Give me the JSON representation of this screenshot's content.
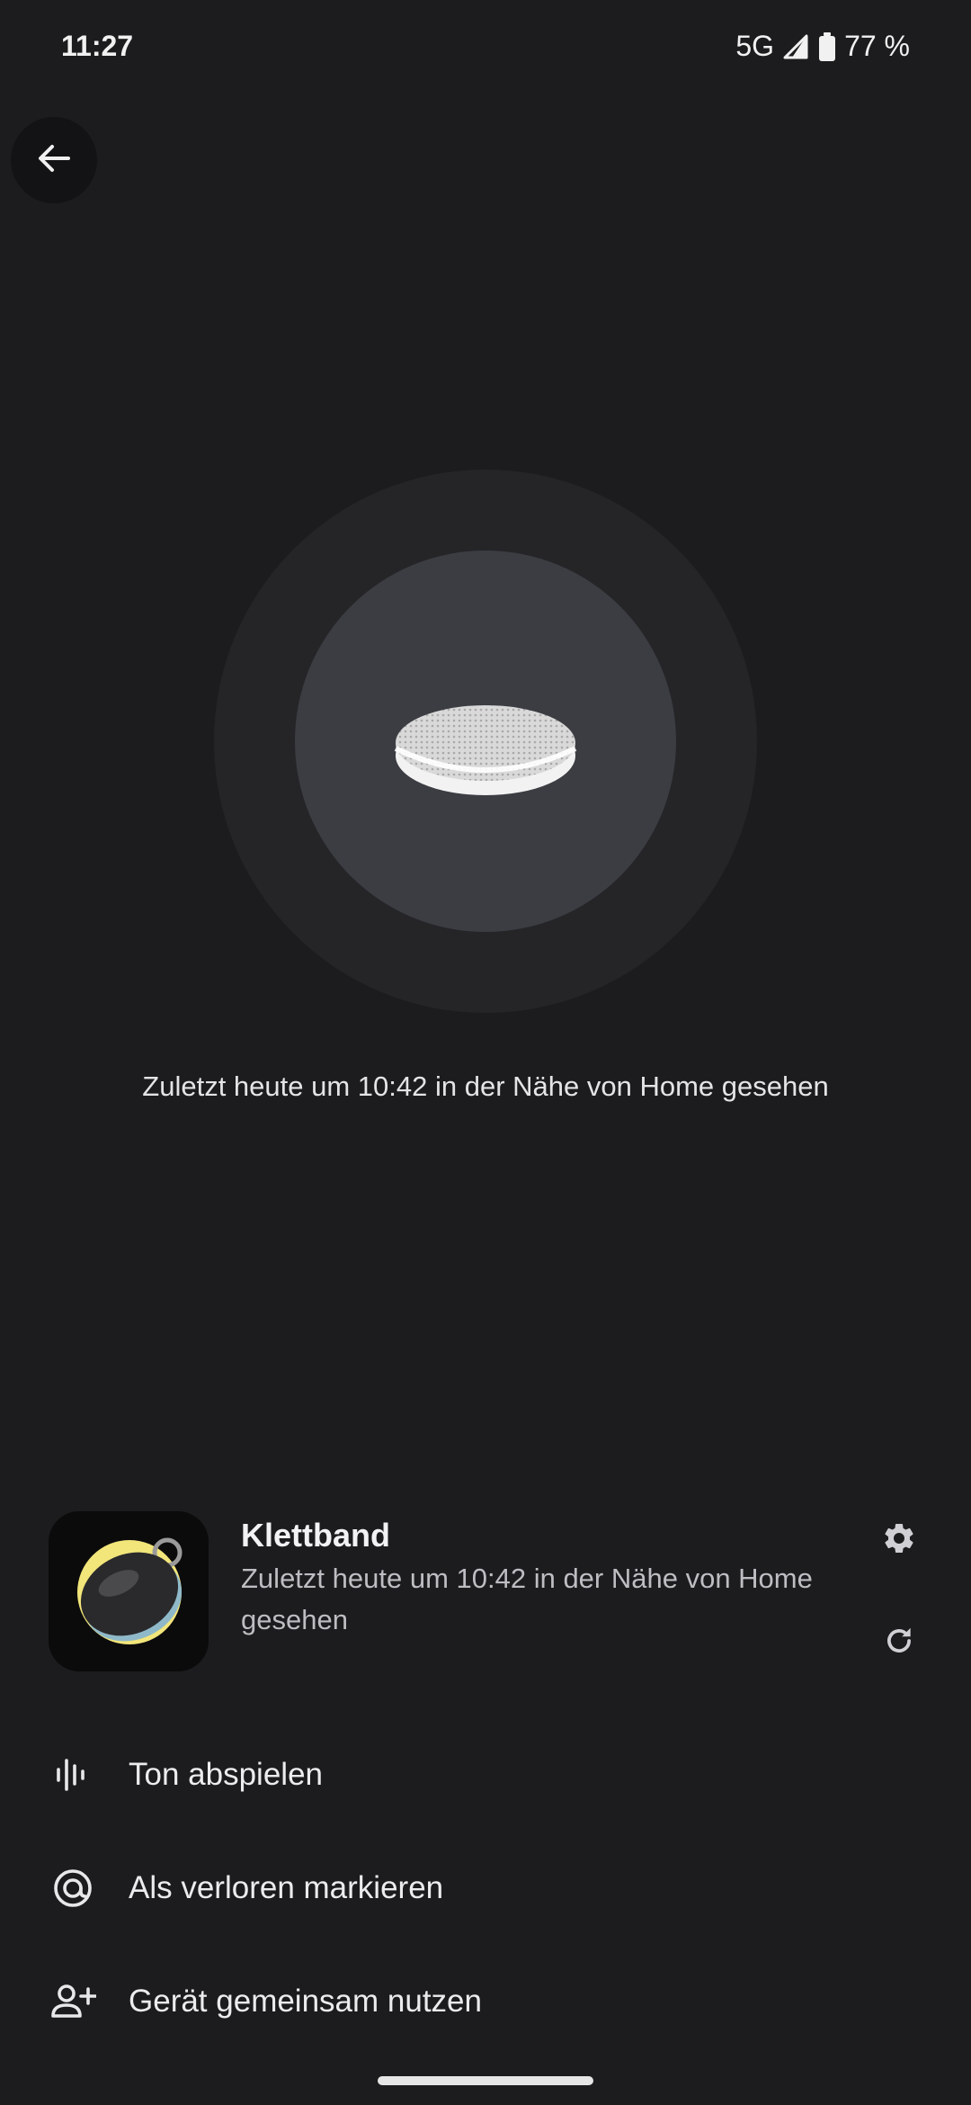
{
  "status_bar": {
    "time": "11:27",
    "network": "5G",
    "battery": "77 %"
  },
  "icons": {
    "back": "arrow-back-icon",
    "signal": "signal-icon",
    "battery": "battery-icon",
    "settings": "gear-icon",
    "refresh": "refresh-icon",
    "sound": "sound-wave-icon",
    "lost": "lost-target-icon",
    "share": "person-add-icon"
  },
  "map": {
    "seen_text": "Zuletzt heute um 10:42 in der Nähe von Home gesehen"
  },
  "device": {
    "name": "Klettband",
    "status": "Zuletzt heute um 10:42 in der Nähe von Home gesehen"
  },
  "actions": {
    "play_sound": "Ton abspielen",
    "mark_lost": "Als verloren markieren",
    "share_device": "Gerät gemeinsam nutzen"
  },
  "colors": {
    "background": "#1c1c1e",
    "outer_circle": "#252528",
    "inner_circle": "#3b3d42",
    "accent_yellow": "#f2e57a"
  }
}
